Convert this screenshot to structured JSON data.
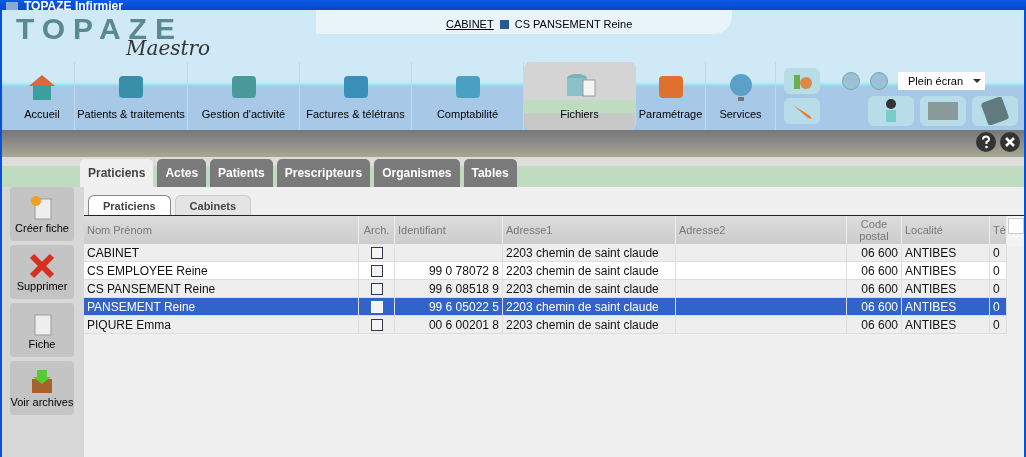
{
  "window": {
    "title": "TOPAZE  Infirmier"
  },
  "logo": {
    "title": "TOPAZE",
    "subtitle": "Maestro"
  },
  "context": {
    "link": "CABINET",
    "user": "CS PANSEMENT Reine"
  },
  "nav": [
    {
      "label": "Accueil",
      "selected": false
    },
    {
      "label": "Patients & traitements",
      "selected": false
    },
    {
      "label": "Gestion d'activité",
      "selected": false
    },
    {
      "label": "Factures & télétrans",
      "selected": false
    },
    {
      "label": "Comptabilité",
      "selected": false
    },
    {
      "label": "Fichiers",
      "selected": true
    },
    {
      "label": "Paramétrage",
      "selected": false
    },
    {
      "label": "Services",
      "selected": false
    }
  ],
  "view_mode": {
    "value": "Plein écran"
  },
  "tabs": [
    {
      "label": "Praticiens",
      "selected": true
    },
    {
      "label": "Actes",
      "selected": false
    },
    {
      "label": "Patients",
      "selected": false
    },
    {
      "label": "Prescripteurs",
      "selected": false
    },
    {
      "label": "Organismes",
      "selected": false
    },
    {
      "label": "Tables",
      "selected": false
    }
  ],
  "subtabs": [
    {
      "label": "Praticiens",
      "selected": true
    },
    {
      "label": "Cabinets",
      "selected": false
    }
  ],
  "sidebar": [
    {
      "label": "Créer fiche"
    },
    {
      "label": "Supprimer"
    },
    {
      "label": "Fiche"
    },
    {
      "label": "Voir archives"
    }
  ],
  "table": {
    "columns": [
      "Nom Prénom",
      "Arch.",
      "Identifiant",
      "Adresse1",
      "Adresse2",
      "Code postal",
      "Localité",
      "Té"
    ],
    "rows": [
      {
        "name": "CABINET",
        "archived": false,
        "id": "",
        "address1": "2203 chemin de saint claude",
        "address2": "",
        "postal": "06 600",
        "city": "ANTIBES",
        "column_8": "0",
        "selected": false
      },
      {
        "name": "CS EMPLOYEE Reine",
        "archived": false,
        "id": "99 0 78072 8",
        "address1": "2203 chemin de saint claude",
        "address2": "",
        "postal": "06 600",
        "city": "ANTIBES",
        "column_8": "0",
        "selected": false
      },
      {
        "name": "CS PANSEMENT Reine",
        "archived": false,
        "id": "99 6 08518 9",
        "address1": "2203 chemin de saint claude",
        "address2": "",
        "postal": "06 600",
        "city": "ANTIBES",
        "column_8": "0",
        "selected": false
      },
      {
        "name": "PANSEMENT Reine",
        "archived": false,
        "id": "99 6 05022 5",
        "address1": "2203 chemin de saint claude",
        "address2": "",
        "postal": "06 600",
        "city": "ANTIBES",
        "column_8": "0",
        "selected": true
      },
      {
        "name": "PIQURE Emma",
        "archived": false,
        "id": "00 6 00201 8",
        "address1": "2203 chemin de saint claude",
        "address2": "",
        "postal": "06 600",
        "city": "ANTIBES",
        "column_8": "0",
        "selected": false
      }
    ]
  }
}
